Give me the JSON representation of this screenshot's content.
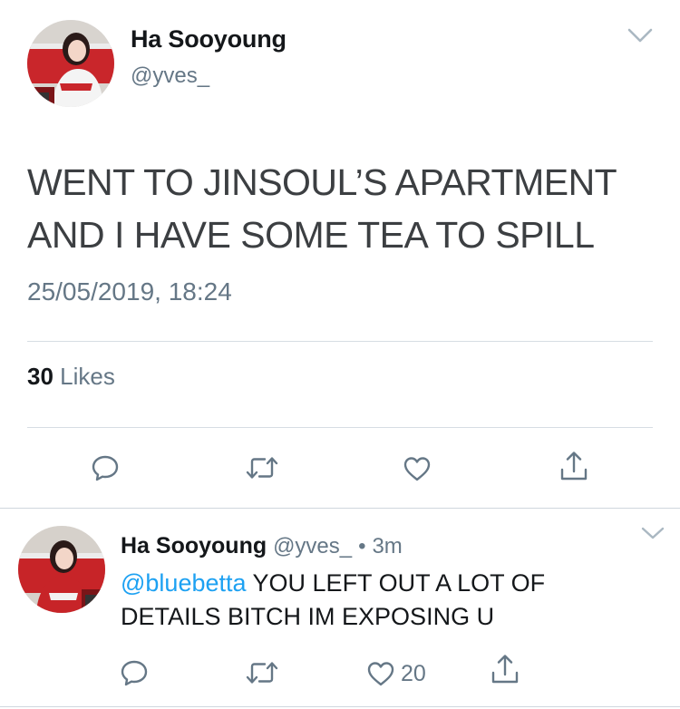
{
  "tweet": {
    "name": "Ha Sooyoung",
    "handle": "@yves_",
    "text": "WENT TO JINSOUL’S APARTMENT AND I HAVE SOME TEA TO SPILL",
    "timestamp": "25/05/2019, 18:24",
    "likes_count": "30",
    "likes_label": "Likes"
  },
  "reply": {
    "name": "Ha Sooyoung",
    "handle": "@yves_",
    "separator": "•",
    "time": "3m",
    "mention": "@bluebetta",
    "text": " YOU LEFT OUT A LOT OF DETAILS BITCH IM EXPOSING U",
    "like_count": "20"
  },
  "icons": {
    "reply": "reply-icon",
    "retweet": "retweet-icon",
    "like": "heart-icon",
    "share": "share-icon",
    "menu": "chevron-down-icon"
  },
  "colors": {
    "accent": "#1da1f2",
    "secondary_text": "#657786",
    "primary_text": "#14171a",
    "tweet_text": "#3c3f42",
    "divider": "#d6dde3"
  }
}
